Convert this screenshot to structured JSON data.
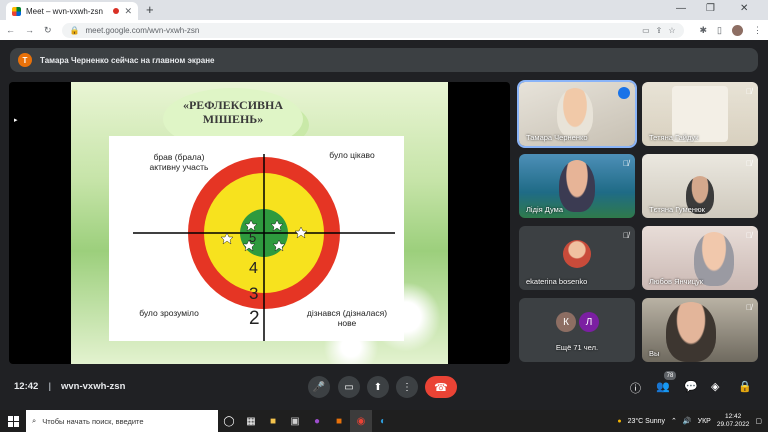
{
  "browser": {
    "tab_title": "Meet – wvn-vxwh-zsn",
    "url": "meet.google.com/wvn-vxwh-zsn",
    "new_tab": "+"
  },
  "banner": {
    "avatar_letter": "Т",
    "text": "Тамара Черненко сейчас на главном экране"
  },
  "slide": {
    "title_line1": "«РЕФЛЕКСИВНА",
    "title_line2": "МІШЕНЬ»",
    "label_top_left": "брав (брала) активну участь",
    "label_top_right": "було цікаво",
    "label_bottom_left": "було зрозуміло",
    "label_bottom_right": "дізнався (дізналася) нове",
    "ring_numbers": [
      "5",
      "4",
      "3",
      "2"
    ]
  },
  "participants": [
    {
      "name": "Тамара Черненко",
      "speaking": true
    },
    {
      "name": "Тетяна Гайдук",
      "muted": true
    },
    {
      "name": "Лідія Дума",
      "muted": true
    },
    {
      "name": "Тєтяна Гуменюк",
      "muted": true
    },
    {
      "name": "ekaterina bosenko",
      "muted": true
    },
    {
      "name": "Любов Янчицук",
      "muted": true
    },
    {
      "name": "Ещё 71 чел.",
      "avatars": [
        "К",
        "Л"
      ]
    },
    {
      "name": "Вы",
      "muted": true
    }
  ],
  "meeting": {
    "time": "12:42",
    "code": "wvn-vxwh-zsn",
    "participant_count": "78"
  },
  "taskbar": {
    "search_placeholder": "Чтобы начать поиск, введите",
    "weather": "23°C  Sunny",
    "lang": "УКР",
    "clock_time": "12:42",
    "clock_date": "29.07.2022"
  },
  "colors": {
    "hangup": "#ea4335",
    "active_speaker": "#8ab4f8",
    "target_red": "#e53524",
    "target_yellow": "#f7e21e",
    "target_green": "#2e9a3e"
  }
}
